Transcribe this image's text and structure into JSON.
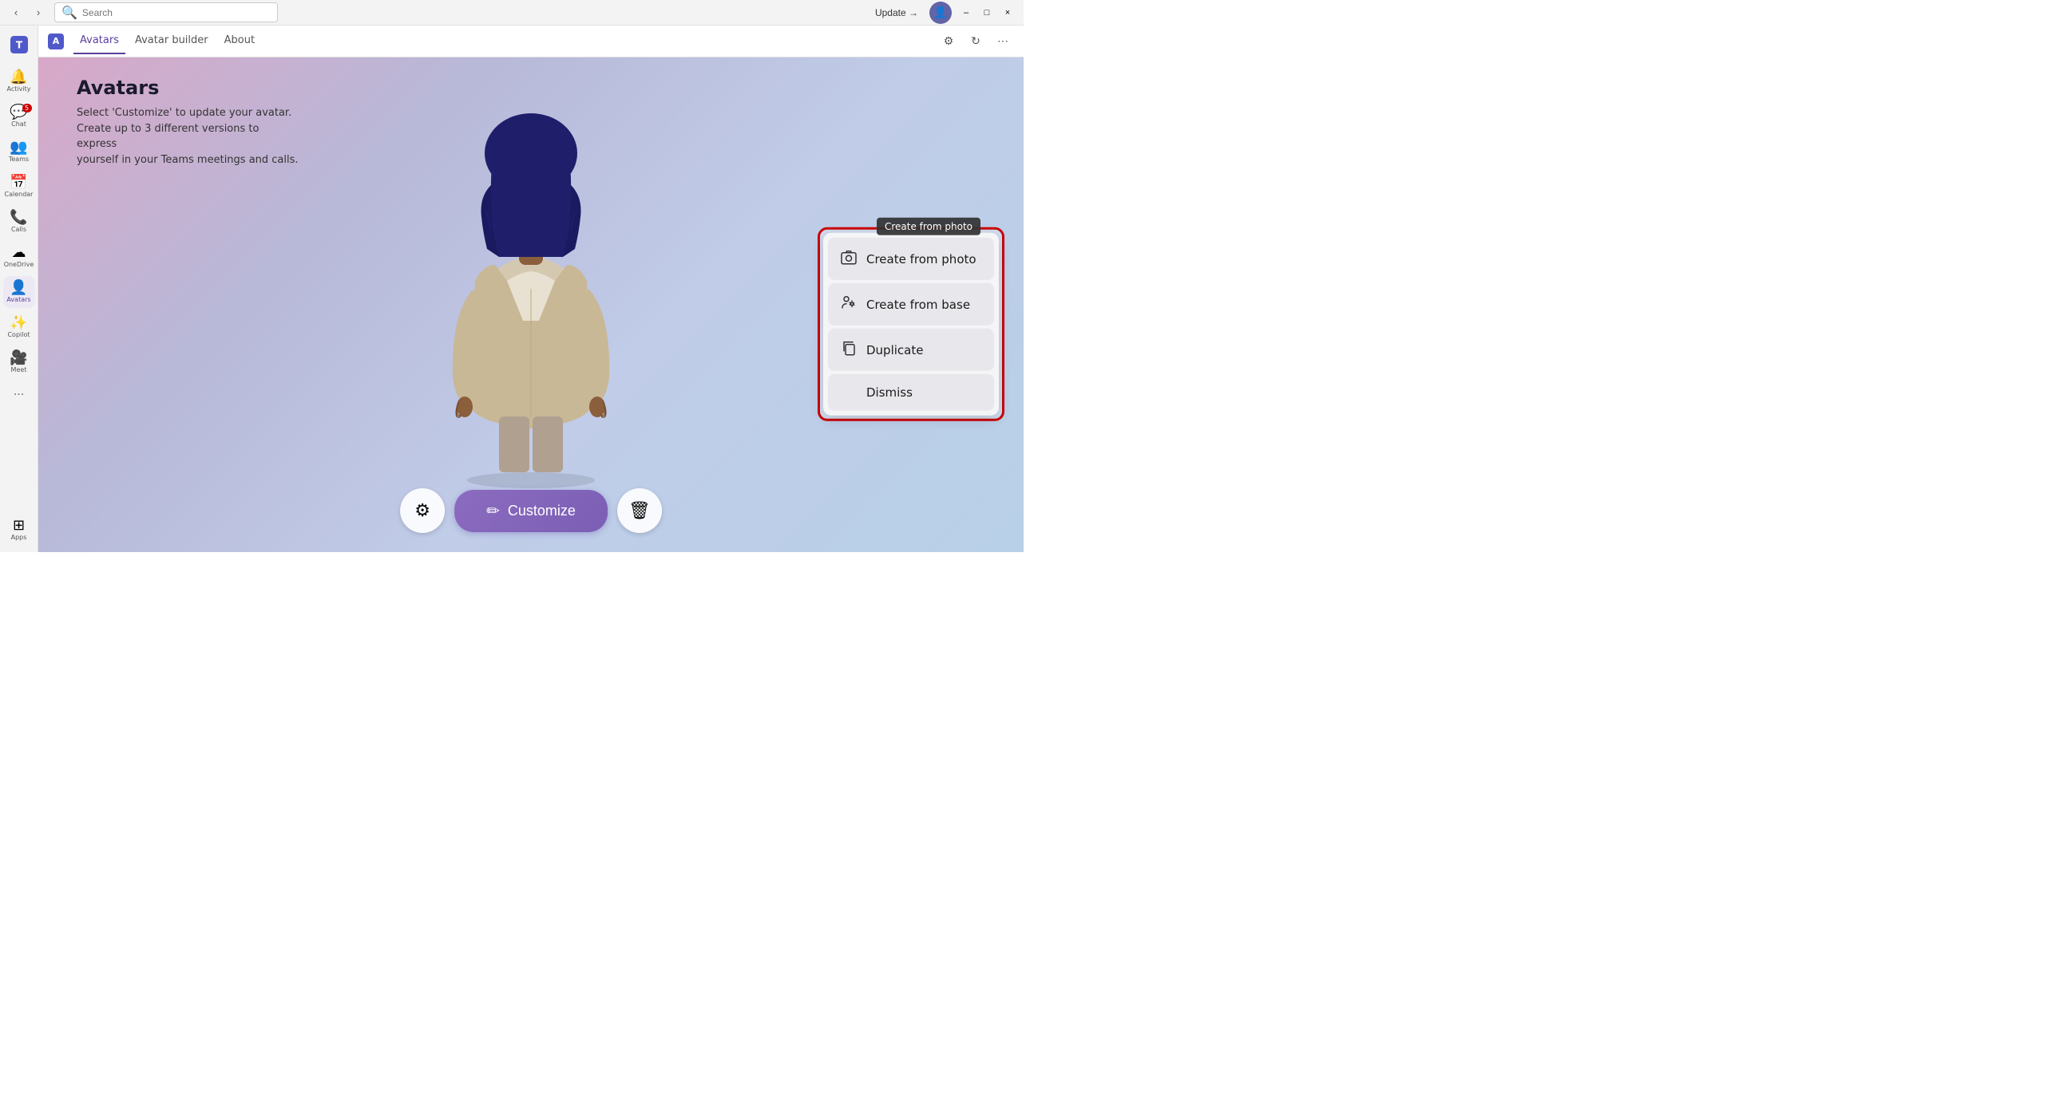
{
  "titlebar": {
    "update_label": "Update →",
    "nav_back": "‹",
    "nav_forward": "›",
    "search_placeholder": "Search",
    "minimize": "–",
    "maximize": "□",
    "close": "×"
  },
  "tabs": {
    "app_name": "Avatars",
    "items": [
      {
        "id": "avatars",
        "label": "Avatars",
        "active": true
      },
      {
        "id": "avatar-builder",
        "label": "Avatar builder",
        "active": false
      },
      {
        "id": "about",
        "label": "About",
        "active": false
      }
    ]
  },
  "sidebar": {
    "items": [
      {
        "id": "activity",
        "label": "Activity",
        "icon": "🔔",
        "badge": ""
      },
      {
        "id": "chat",
        "label": "Chat",
        "icon": "💬",
        "badge": "5"
      },
      {
        "id": "teams",
        "label": "Teams",
        "icon": "👥",
        "badge": ""
      },
      {
        "id": "calendar",
        "label": "Calendar",
        "icon": "📅",
        "badge": ""
      },
      {
        "id": "calls",
        "label": "Calls",
        "icon": "📞",
        "badge": ""
      },
      {
        "id": "onedrive",
        "label": "OneDrive",
        "icon": "☁",
        "badge": ""
      },
      {
        "id": "avatars",
        "label": "Avatars",
        "icon": "👤",
        "badge": "",
        "active": true
      },
      {
        "id": "copilot",
        "label": "Copilot",
        "icon": "✨",
        "badge": ""
      },
      {
        "id": "meet",
        "label": "Meet",
        "icon": "🎥",
        "badge": ""
      },
      {
        "id": "apps",
        "label": "Apps",
        "icon": "⬜",
        "badge": ""
      }
    ]
  },
  "page": {
    "title": "Avatars",
    "description_line1": "Select 'Customize' to update your avatar.",
    "description_line2": "Create up to 3 different versions to express",
    "description_line3": "yourself in your Teams meetings and calls."
  },
  "toolbar": {
    "customize_label": "Customize",
    "customize_icon": "✏"
  },
  "context_menu": {
    "tooltip": "Create from photo",
    "items": [
      {
        "id": "create-from-photo",
        "label": "Create from photo",
        "icon": "📷"
      },
      {
        "id": "create-from-base",
        "label": "Create from base",
        "icon": "👥"
      },
      {
        "id": "duplicate",
        "label": "Duplicate",
        "icon": "🗋"
      },
      {
        "id": "dismiss",
        "label": "Dismiss",
        "icon": ""
      }
    ]
  }
}
